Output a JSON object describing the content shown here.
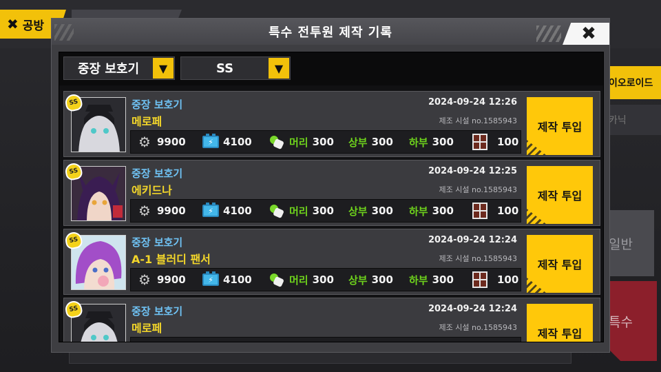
{
  "background": {
    "back_label": "공방",
    "side_yellow_label": "이오로이드",
    "side_gray_label": "카닉",
    "side_normal_label": "일반",
    "side_special_label": "특수"
  },
  "modal": {
    "title": "특수 전투원 제작 기록",
    "close_icon": "close-icon",
    "filters": {
      "type_value": "중장 보호기",
      "rank_value": "SS",
      "arrow_glyph": "▼"
    },
    "records": [
      {
        "type": "중장 보호기",
        "name": "메로페",
        "datetime": "2024-09-24 12:26",
        "facility": "제조 시설 no.1585943",
        "rank": "SS",
        "parts_value": "9900",
        "nutrient_value": "4100",
        "head_label": "머리",
        "head_value": "300",
        "upper_label": "상부",
        "upper_value": "300",
        "lower_label": "하부",
        "lower_value": "300",
        "module_value": "100",
        "button_label": "제작 투입"
      },
      {
        "type": "중장 보호기",
        "name": "에키드나",
        "datetime": "2024-09-24 12:25",
        "facility": "제조 시설 no.1585943",
        "rank": "SS",
        "parts_value": "9900",
        "nutrient_value": "4100",
        "head_label": "머리",
        "head_value": "300",
        "upper_label": "상부",
        "upper_value": "300",
        "lower_label": "하부",
        "lower_value": "300",
        "module_value": "100",
        "button_label": "제작 투입"
      },
      {
        "type": "중장 보호기",
        "name": "A-1 블러디 팬서",
        "datetime": "2024-09-24 12:24",
        "facility": "제조 시설 no.1585943",
        "rank": "SS",
        "parts_value": "9900",
        "nutrient_value": "4100",
        "head_label": "머리",
        "head_value": "300",
        "upper_label": "상부",
        "upper_value": "300",
        "lower_label": "하부",
        "lower_value": "300",
        "module_value": "100",
        "button_label": "제작 투입"
      },
      {
        "type": "중장 보호기",
        "name": "메로페",
        "datetime": "2024-09-24 12:24",
        "facility": "제조 시설 no.1585943",
        "rank": "SS",
        "button_label": "제작 투입"
      }
    ]
  },
  "colors": {
    "accent_yellow": "#ffc80a",
    "type_blue": "#6fc2f4",
    "name_yellow": "#f3d62a",
    "part_green": "#6ed21c"
  }
}
